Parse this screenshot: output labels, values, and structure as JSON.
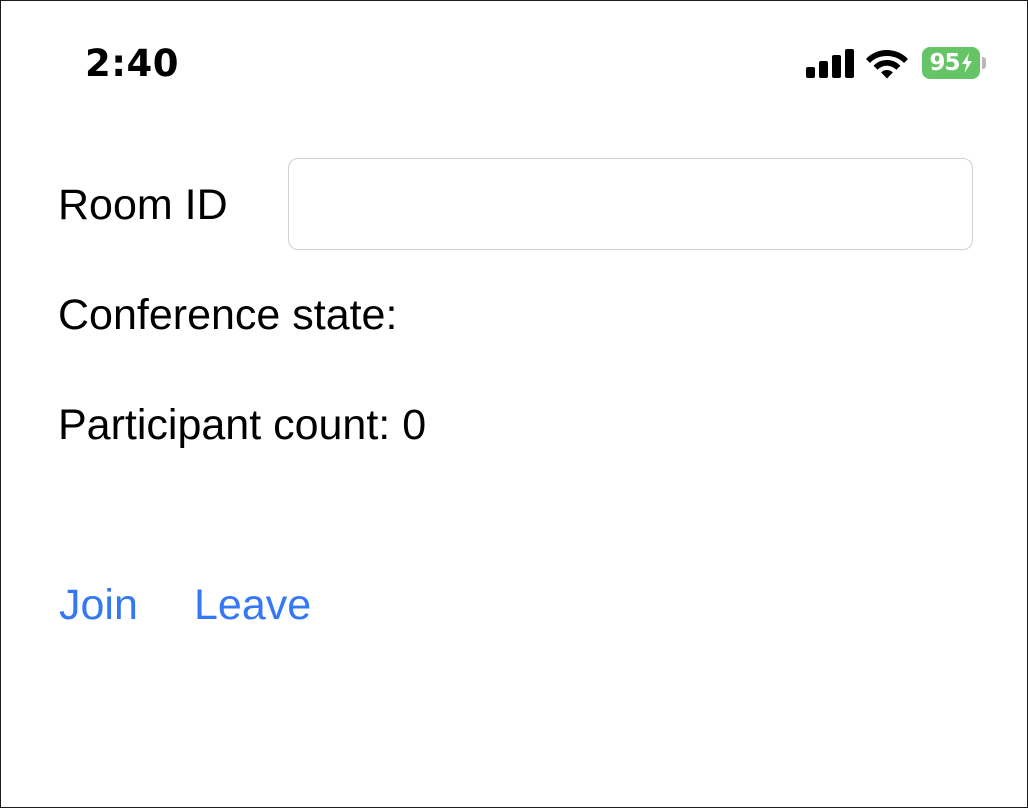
{
  "status_bar": {
    "time": "2:40",
    "battery_level": "95",
    "battery_color": "#65c466",
    "icons": [
      "cellular-signal-icon",
      "wifi-icon",
      "battery-charging-icon"
    ]
  },
  "room": {
    "label": "Room ID",
    "value": "",
    "placeholder": ""
  },
  "conference": {
    "state_text": "Conference state:",
    "participant_text": "Participant count: 0"
  },
  "actions": {
    "join_label": "Join",
    "leave_label": "Leave",
    "accent_color": "#3478f6"
  }
}
